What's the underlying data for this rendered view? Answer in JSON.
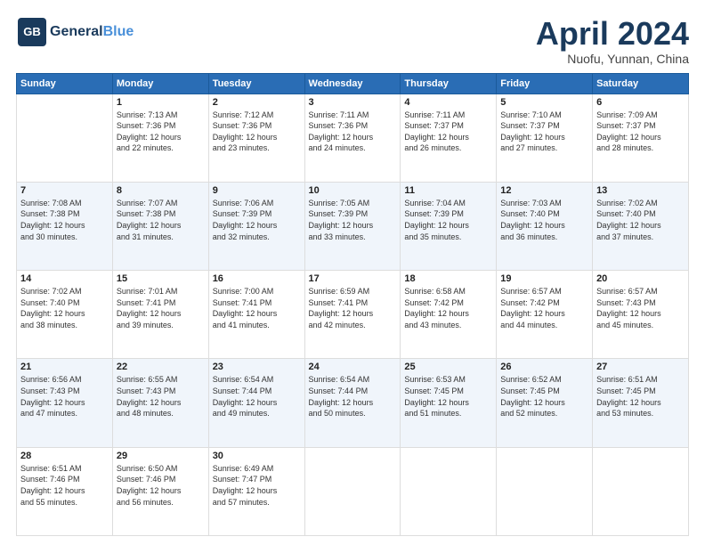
{
  "header": {
    "logo_line1": "General",
    "logo_line2": "Blue",
    "month_title": "April 2024",
    "location": "Nuofu, Yunnan, China"
  },
  "weekdays": [
    "Sunday",
    "Monday",
    "Tuesday",
    "Wednesday",
    "Thursday",
    "Friday",
    "Saturday"
  ],
  "weeks": [
    [
      null,
      {
        "day": 1,
        "sunrise": "7:13 AM",
        "sunset": "7:36 PM",
        "daylight": "12 hours and 22 minutes."
      },
      {
        "day": 2,
        "sunrise": "7:12 AM",
        "sunset": "7:36 PM",
        "daylight": "12 hours and 23 minutes."
      },
      {
        "day": 3,
        "sunrise": "7:11 AM",
        "sunset": "7:36 PM",
        "daylight": "12 hours and 24 minutes."
      },
      {
        "day": 4,
        "sunrise": "7:11 AM",
        "sunset": "7:37 PM",
        "daylight": "12 hours and 26 minutes."
      },
      {
        "day": 5,
        "sunrise": "7:10 AM",
        "sunset": "7:37 PM",
        "daylight": "12 hours and 27 minutes."
      },
      {
        "day": 6,
        "sunrise": "7:09 AM",
        "sunset": "7:37 PM",
        "daylight": "12 hours and 28 minutes."
      }
    ],
    [
      {
        "day": 7,
        "sunrise": "7:08 AM",
        "sunset": "7:38 PM",
        "daylight": "12 hours and 30 minutes."
      },
      {
        "day": 8,
        "sunrise": "7:07 AM",
        "sunset": "7:38 PM",
        "daylight": "12 hours and 31 minutes."
      },
      {
        "day": 9,
        "sunrise": "7:06 AM",
        "sunset": "7:39 PM",
        "daylight": "12 hours and 32 minutes."
      },
      {
        "day": 10,
        "sunrise": "7:05 AM",
        "sunset": "7:39 PM",
        "daylight": "12 hours and 33 minutes."
      },
      {
        "day": 11,
        "sunrise": "7:04 AM",
        "sunset": "7:39 PM",
        "daylight": "12 hours and 35 minutes."
      },
      {
        "day": 12,
        "sunrise": "7:03 AM",
        "sunset": "7:40 PM",
        "daylight": "12 hours and 36 minutes."
      },
      {
        "day": 13,
        "sunrise": "7:02 AM",
        "sunset": "7:40 PM",
        "daylight": "12 hours and 37 minutes."
      }
    ],
    [
      {
        "day": 14,
        "sunrise": "7:02 AM",
        "sunset": "7:40 PM",
        "daylight": "12 hours and 38 minutes."
      },
      {
        "day": 15,
        "sunrise": "7:01 AM",
        "sunset": "7:41 PM",
        "daylight": "12 hours and 39 minutes."
      },
      {
        "day": 16,
        "sunrise": "7:00 AM",
        "sunset": "7:41 PM",
        "daylight": "12 hours and 41 minutes."
      },
      {
        "day": 17,
        "sunrise": "6:59 AM",
        "sunset": "7:41 PM",
        "daylight": "12 hours and 42 minutes."
      },
      {
        "day": 18,
        "sunrise": "6:58 AM",
        "sunset": "7:42 PM",
        "daylight": "12 hours and 43 minutes."
      },
      {
        "day": 19,
        "sunrise": "6:57 AM",
        "sunset": "7:42 PM",
        "daylight": "12 hours and 44 minutes."
      },
      {
        "day": 20,
        "sunrise": "6:57 AM",
        "sunset": "7:43 PM",
        "daylight": "12 hours and 45 minutes."
      }
    ],
    [
      {
        "day": 21,
        "sunrise": "6:56 AM",
        "sunset": "7:43 PM",
        "daylight": "12 hours and 47 minutes."
      },
      {
        "day": 22,
        "sunrise": "6:55 AM",
        "sunset": "7:43 PM",
        "daylight": "12 hours and 48 minutes."
      },
      {
        "day": 23,
        "sunrise": "6:54 AM",
        "sunset": "7:44 PM",
        "daylight": "12 hours and 49 minutes."
      },
      {
        "day": 24,
        "sunrise": "6:54 AM",
        "sunset": "7:44 PM",
        "daylight": "12 hours and 50 minutes."
      },
      {
        "day": 25,
        "sunrise": "6:53 AM",
        "sunset": "7:45 PM",
        "daylight": "12 hours and 51 minutes."
      },
      {
        "day": 26,
        "sunrise": "6:52 AM",
        "sunset": "7:45 PM",
        "daylight": "12 hours and 52 minutes."
      },
      {
        "day": 27,
        "sunrise": "6:51 AM",
        "sunset": "7:45 PM",
        "daylight": "12 hours and 53 minutes."
      }
    ],
    [
      {
        "day": 28,
        "sunrise": "6:51 AM",
        "sunset": "7:46 PM",
        "daylight": "12 hours and 55 minutes."
      },
      {
        "day": 29,
        "sunrise": "6:50 AM",
        "sunset": "7:46 PM",
        "daylight": "12 hours and 56 minutes."
      },
      {
        "day": 30,
        "sunrise": "6:49 AM",
        "sunset": "7:47 PM",
        "daylight": "12 hours and 57 minutes."
      },
      null,
      null,
      null,
      null
    ]
  ],
  "labels": {
    "sunrise_prefix": "Sunrise: ",
    "sunset_prefix": "Sunset: ",
    "daylight_prefix": "Daylight: "
  }
}
